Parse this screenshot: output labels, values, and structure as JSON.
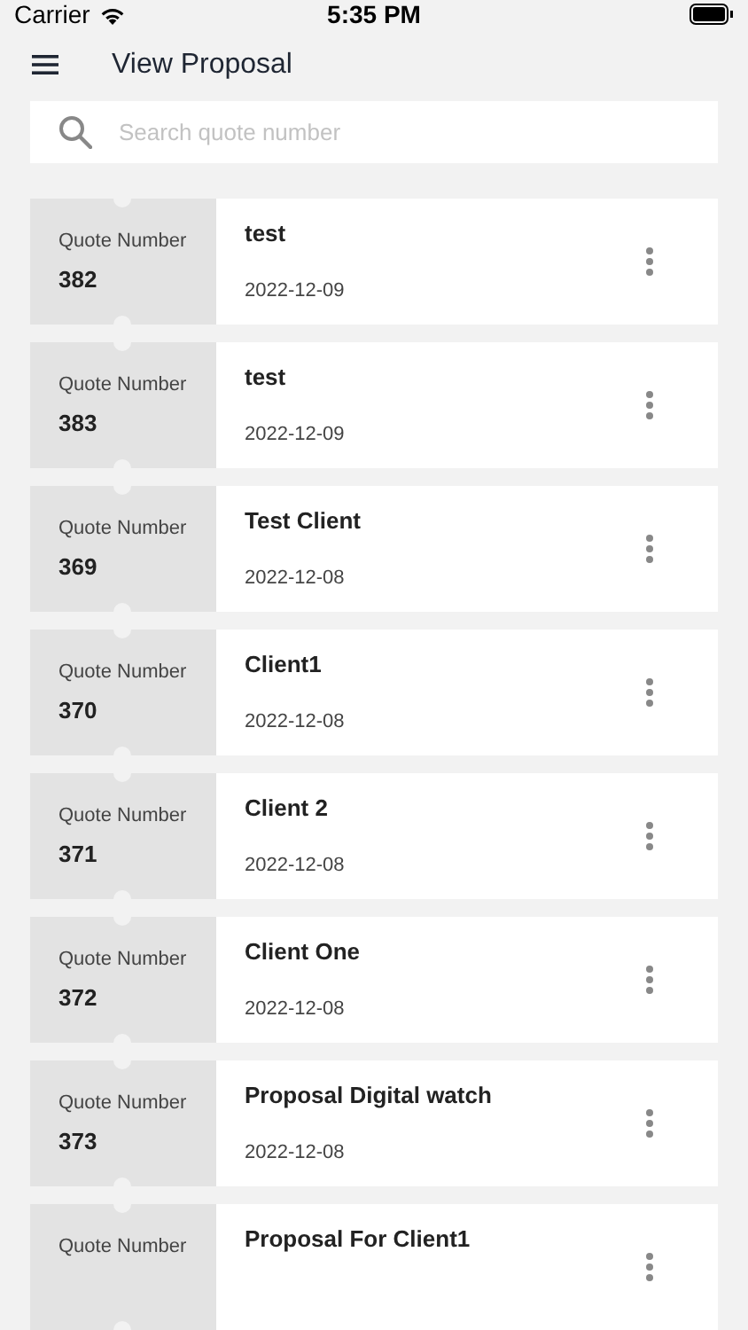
{
  "status_bar": {
    "carrier": "Carrier",
    "time": "5:35 PM"
  },
  "header": {
    "title": "View Proposal"
  },
  "search": {
    "placeholder": "Search quote number"
  },
  "quotes": [
    {
      "label": "Quote Number",
      "number": "382",
      "client": "test",
      "date": "2022-12-09"
    },
    {
      "label": "Quote Number",
      "number": "383",
      "client": "test",
      "date": "2022-12-09"
    },
    {
      "label": "Quote Number",
      "number": "369",
      "client": "Test Client",
      "date": "2022-12-08"
    },
    {
      "label": "Quote Number",
      "number": "370",
      "client": "Client1",
      "date": "2022-12-08"
    },
    {
      "label": "Quote Number",
      "number": "371",
      "client": "Client 2",
      "date": "2022-12-08"
    },
    {
      "label": "Quote Number",
      "number": "372",
      "client": "Client One",
      "date": "2022-12-08"
    },
    {
      "label": "Quote Number",
      "number": "373",
      "client": "Proposal Digital watch",
      "date": "2022-12-08"
    },
    {
      "label": "Quote Number",
      "client": "Proposal For Client1"
    }
  ]
}
